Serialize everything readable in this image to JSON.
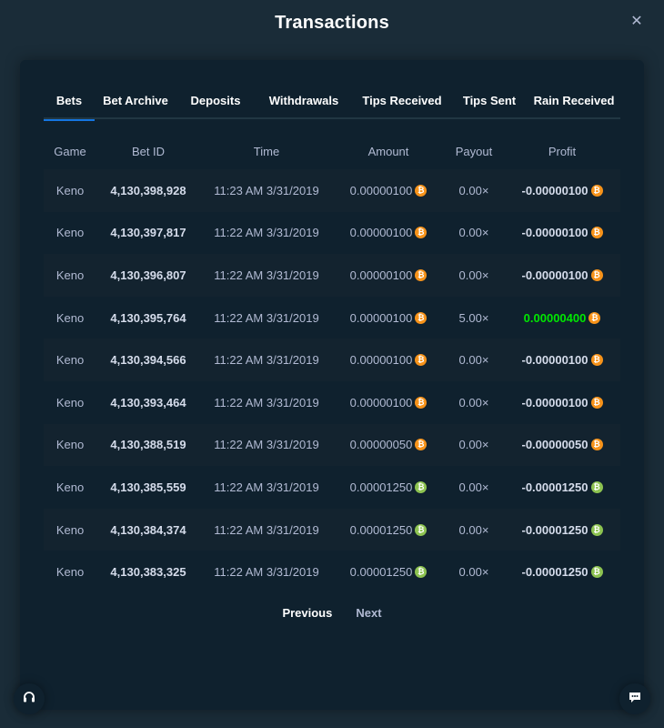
{
  "modal": {
    "title": "Transactions",
    "close_icon": "close-icon"
  },
  "tabs": [
    {
      "label": "Bets",
      "active": true
    },
    {
      "label": "Bet Archive",
      "active": false
    },
    {
      "label": "Deposits",
      "active": false
    },
    {
      "label": "Withdrawals",
      "active": false
    },
    {
      "label": "Tips Received",
      "active": false
    },
    {
      "label": "Tips Sent",
      "active": false
    },
    {
      "label": "Rain Received",
      "active": false
    }
  ],
  "table": {
    "headers": {
      "game": "Game",
      "bet_id": "Bet ID",
      "time": "Time",
      "amount": "Amount",
      "payout": "Payout",
      "profit": "Profit"
    },
    "rows": [
      {
        "game": "Keno",
        "bet_id": "4,130,398,928",
        "time": "11:23 AM 3/31/2019",
        "amount": "0.00000100",
        "payout": "0.00×",
        "profit": "-0.00000100",
        "currency": "btc",
        "win": false
      },
      {
        "game": "Keno",
        "bet_id": "4,130,397,817",
        "time": "11:22 AM 3/31/2019",
        "amount": "0.00000100",
        "payout": "0.00×",
        "profit": "-0.00000100",
        "currency": "btc",
        "win": false
      },
      {
        "game": "Keno",
        "bet_id": "4,130,396,807",
        "time": "11:22 AM 3/31/2019",
        "amount": "0.00000100",
        "payout": "0.00×",
        "profit": "-0.00000100",
        "currency": "btc",
        "win": false
      },
      {
        "game": "Keno",
        "bet_id": "4,130,395,764",
        "time": "11:22 AM 3/31/2019",
        "amount": "0.00000100",
        "payout": "5.00×",
        "profit": "0.00000400",
        "currency": "btc",
        "win": true
      },
      {
        "game": "Keno",
        "bet_id": "4,130,394,566",
        "time": "11:22 AM 3/31/2019",
        "amount": "0.00000100",
        "payout": "0.00×",
        "profit": "-0.00000100",
        "currency": "btc",
        "win": false
      },
      {
        "game": "Keno",
        "bet_id": "4,130,393,464",
        "time": "11:22 AM 3/31/2019",
        "amount": "0.00000100",
        "payout": "0.00×",
        "profit": "-0.00000100",
        "currency": "btc",
        "win": false
      },
      {
        "game": "Keno",
        "bet_id": "4,130,388,519",
        "time": "11:22 AM 3/31/2019",
        "amount": "0.00000050",
        "payout": "0.00×",
        "profit": "-0.00000050",
        "currency": "btc",
        "win": false
      },
      {
        "game": "Keno",
        "bet_id": "4,130,385,559",
        "time": "11:22 AM 3/31/2019",
        "amount": "0.00001250",
        "payout": "0.00×",
        "profit": "-0.00001250",
        "currency": "bch",
        "win": false
      },
      {
        "game": "Keno",
        "bet_id": "4,130,384,374",
        "time": "11:22 AM 3/31/2019",
        "amount": "0.00001250",
        "payout": "0.00×",
        "profit": "-0.00001250",
        "currency": "bch",
        "win": false
      },
      {
        "game": "Keno",
        "bet_id": "4,130,383,325",
        "time": "11:22 AM 3/31/2019",
        "amount": "0.00001250",
        "payout": "0.00×",
        "profit": "-0.00001250",
        "currency": "bch",
        "win": false
      }
    ]
  },
  "pagination": {
    "previous_label": "Previous",
    "next_label": "Next"
  },
  "colors": {
    "background": "#1a2c38",
    "panel": "#0f212e",
    "accent": "#1475e1",
    "win": "#00e701",
    "btc": "#f7931a",
    "bch": "#8dc351"
  },
  "icons": {
    "support": "headset-icon",
    "chat": "chat-icon",
    "btc": "bitcoin-coin-icon",
    "bch": "bitcoin-cash-coin-icon"
  }
}
